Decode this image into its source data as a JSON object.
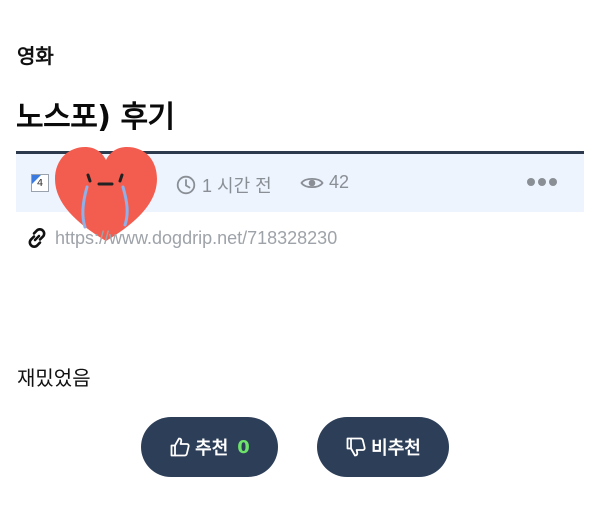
{
  "post": {
    "category": "영화",
    "title": "노스포) 후기",
    "level_badge": "4",
    "time_ago": "1 시간 전",
    "view_count": "42",
    "url": "https://www.dogdrip.net/718328230",
    "body": "재밌었음"
  },
  "votes": {
    "up_label": "추천",
    "up_count": "0",
    "down_label": "비추천"
  },
  "colors": {
    "accent_navy": "#2d3e58",
    "meta_bg": "#eef4fd",
    "vote_count_green": "#6ee36a",
    "avatar_heart": "#f35d4f"
  },
  "icons": [
    "clock-icon",
    "eye-icon",
    "more-icon",
    "link-icon",
    "thumbs-up-icon",
    "thumbs-down-icon",
    "crying-heart-avatar"
  ]
}
